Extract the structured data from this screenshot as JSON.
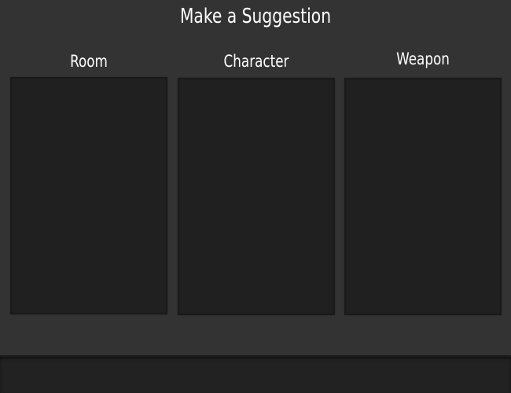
{
  "dialog": {
    "title": "Make a Suggestion"
  },
  "columns": [
    {
      "label": "Room",
      "items": []
    },
    {
      "label": "Character",
      "items": []
    },
    {
      "label": "Weapon",
      "items": []
    }
  ],
  "colors": {
    "background": "#333333",
    "list_background": "#202020",
    "bottom_bar": "#222222",
    "text": "#ffffff"
  }
}
